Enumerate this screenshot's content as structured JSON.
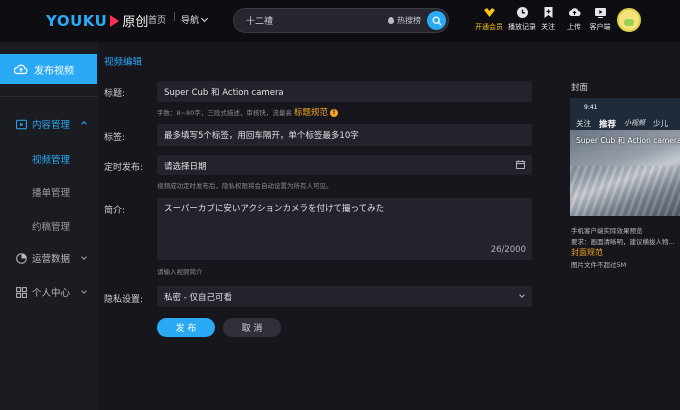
{
  "header": {
    "logo_text": "YOUKU",
    "logo_sub": "原创",
    "home": "首页",
    "nav_menu": "导航",
    "search_value": "十二禮",
    "hot_search": "热搜榜",
    "tools": [
      {
        "icon": "vip-icon",
        "label": "开通会员"
      },
      {
        "icon": "history-icon",
        "label": "播放记录"
      },
      {
        "icon": "bookmark-icon",
        "label": "关注"
      },
      {
        "icon": "upload-icon",
        "label": "上传"
      },
      {
        "icon": "tv-icon",
        "label": "客户端"
      }
    ],
    "colors": {
      "brand_blue": "#2aa9f5",
      "brand_red": "#ff2d55",
      "vip_gold": "#f5c518"
    }
  },
  "sidebar": {
    "publish": "发布视频",
    "content_manage": "内容管理",
    "video_manage": "视频管理",
    "playlist_manage": "播单管理",
    "draft_manage": "约稿管理",
    "ops_data": "运营数据",
    "personal_center": "个人中心"
  },
  "form": {
    "section_title": "视频编辑",
    "title_label": "标题:",
    "title_value": "Super Cub 和 Action camera",
    "title_hint": "字数：8~80字，三段式描述，审核快，流量高",
    "title_rule": "标题规范",
    "tags_label": "标签:",
    "tags_placeholder": "最多填写5个标签，用回车隔开，单个标签最多10字",
    "schedule_label": "定时发布:",
    "schedule_placeholder": "请选择日期",
    "schedule_hint": "视频成功定时发布后，隐私权限将会自动设置为所有人可见。",
    "intro_label": "简介:",
    "intro_value": "スーパーカブに安いアクションカメラを付けて撮ってみた",
    "intro_counter": "26/2000",
    "intro_hint": "请输入视频简介",
    "privacy_label": "隐私设置:",
    "privacy_value": "私密 - 仅自己可看",
    "submit": "发 布",
    "cancel": "取 消"
  },
  "cover": {
    "title": "封面",
    "preview_time": "9:41",
    "preview_tabs": [
      "关注",
      "推荐",
      "小视频",
      "少儿"
    ],
    "preview_caption": "Super Cub 和 Action camera",
    "note1": "手机客户端实际效果预览",
    "note2": "要求：画面清晰明，建议横拔人物...",
    "rule": "封面规范",
    "note3": "图片文件不超过5M"
  }
}
